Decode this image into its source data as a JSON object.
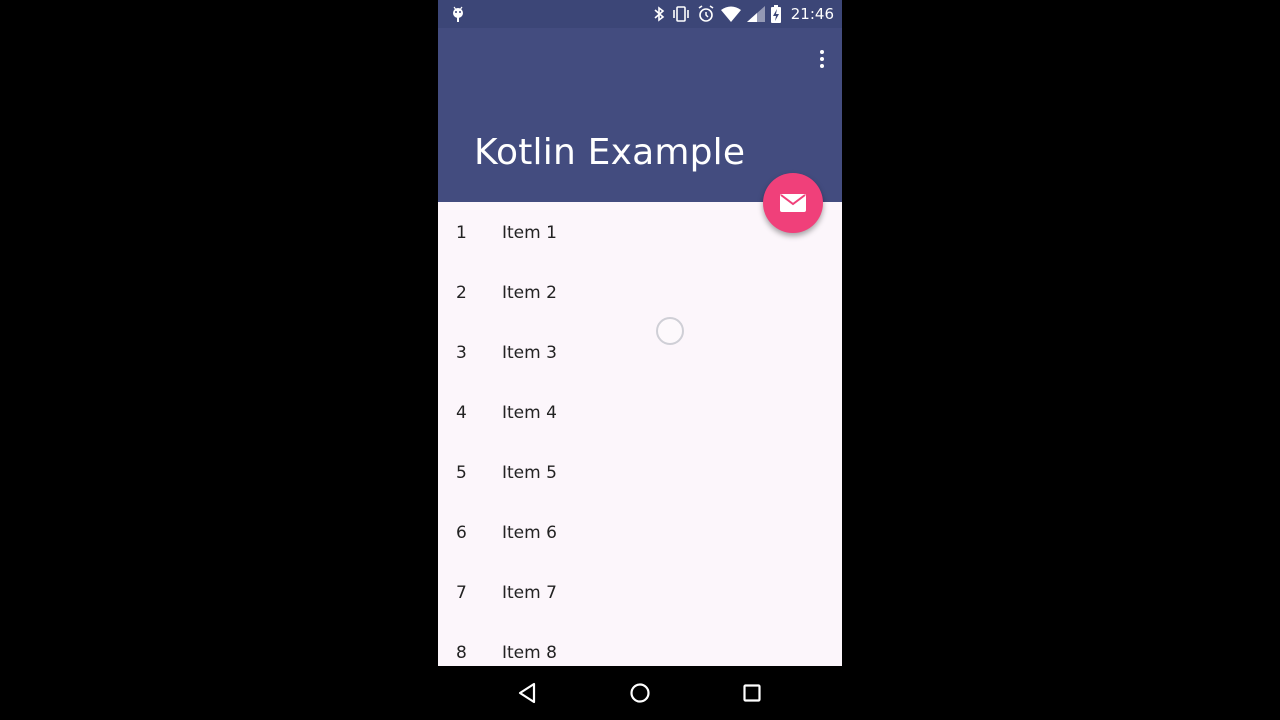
{
  "status_bar": {
    "time": "21:46",
    "icons": [
      "android-debug-icon",
      "bluetooth-icon",
      "vibrate-icon",
      "alarm-icon",
      "wifi-icon",
      "cell-signal-icon",
      "battery-charging-icon"
    ]
  },
  "app_bar": {
    "title": "Kotlin Example",
    "overflow_icon": "more-vert-icon"
  },
  "fab": {
    "icon": "email-icon"
  },
  "list": {
    "items": [
      {
        "num": "1",
        "label": "Item 1"
      },
      {
        "num": "2",
        "label": "Item 2"
      },
      {
        "num": "3",
        "label": "Item 3"
      },
      {
        "num": "4",
        "label": "Item 4"
      },
      {
        "num": "5",
        "label": "Item 5"
      },
      {
        "num": "6",
        "label": "Item 6"
      },
      {
        "num": "7",
        "label": "Item 7"
      },
      {
        "num": "8",
        "label": "Item 8"
      }
    ]
  },
  "nav_bar": {
    "icons": [
      "back-icon",
      "home-icon",
      "recents-icon"
    ]
  },
  "colors": {
    "status_bar": "#3c4677",
    "app_bar": "#434c7f",
    "fab": "#f0407a",
    "content_bg": "#fcf6fb"
  }
}
